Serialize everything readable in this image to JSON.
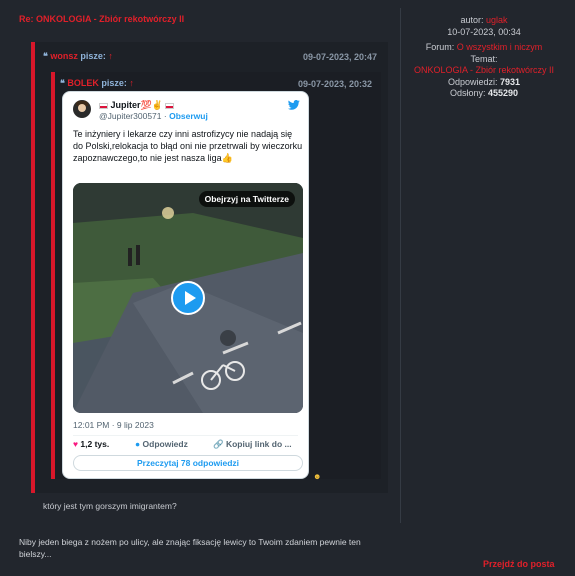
{
  "post": {
    "title": "Re: ONKOLOGIA - Zbiór rekotwórczy II",
    "reply_text": "Niby jeden biega z nożem po ulicy, ale znając fiksację lewicy to Twoim zdaniem pewnie ten bielszy...",
    "goto_label": "Przejdź do posta"
  },
  "info": {
    "author_label": "autor:",
    "author": "uglak",
    "date": "10-07-2023, 00:34",
    "forum_label": "Forum:",
    "forum": "O wszystkim i niczym",
    "topic_label": "Temat:",
    "topic": "ONKOLOGIA - Zbiór rekotwórczy II",
    "replies_label": "Odpowiedzi:",
    "replies": "7931",
    "views_label": "Odsłony:",
    "views": "455290"
  },
  "quote1": {
    "user": "wonsz",
    "says": "pisze:",
    "date": "09-07-2023, 20:47",
    "text": "który jest tym gorszym imigrantem?"
  },
  "quote2": {
    "user": "BOLEK",
    "says": "pisze:",
    "date": "09-07-2023, 20:32"
  },
  "tweet": {
    "name": "Jupiter💯✌",
    "handle": "@Jupiter300571",
    "dot": "·",
    "follow": "Obserwuj",
    "text": "Te inżyniery i lekarze czy inni astrofizycy nie nadają się do Polski,relokacja to błąd oni nie przetrwali by wieczorku zapoznawczego,to nie jest nasza liga👍",
    "watch_label": "Obejrzyj na Twitterze",
    "timestamp": "12:01 PM · 9 lip 2023",
    "likes": "1,2 tys.",
    "reply_label": "Odpowiedz",
    "copy_label": "Kopiuj link do ...",
    "read_replies": "Przeczytaj 78 odpowiedzi"
  },
  "colors": {
    "accent_red": "#e0202a",
    "quote_border": "#d8172a",
    "twitter_blue": "#1d9bf0",
    "page_bg": "#22262d"
  },
  "icons": [
    "quote-icon",
    "arrow-up-icon",
    "twitter-bird-icon",
    "play-icon",
    "heart-icon",
    "reply-bubble-icon",
    "link-icon",
    "emoji-icon"
  ]
}
